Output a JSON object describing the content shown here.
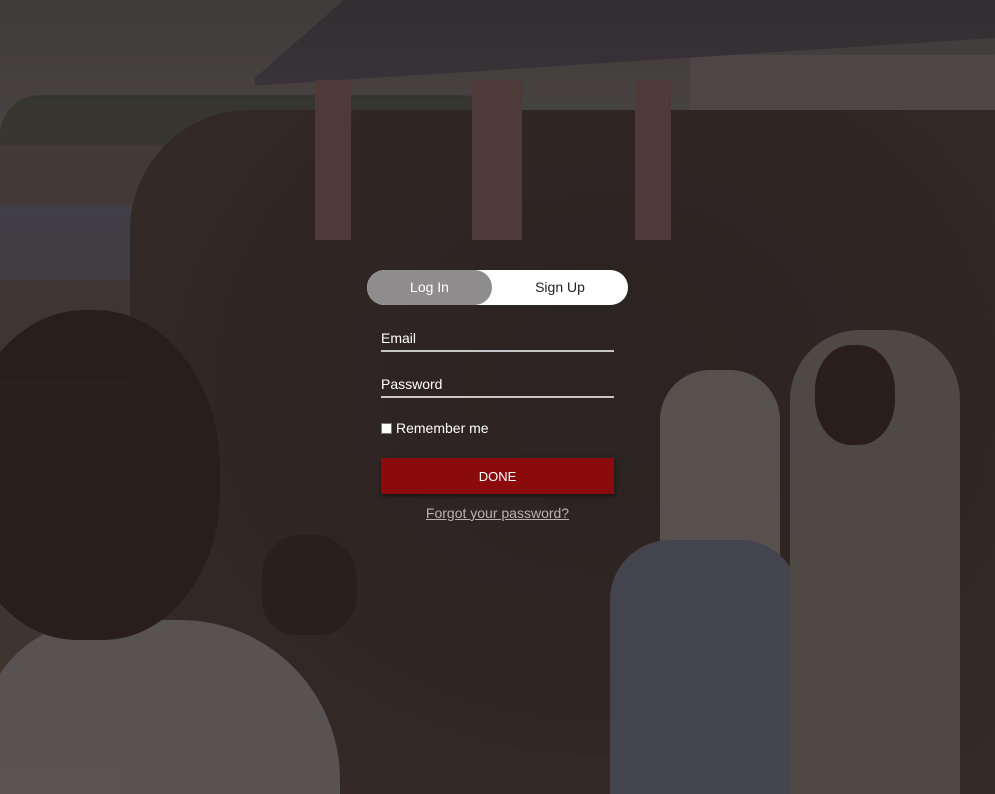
{
  "tabs": {
    "login": "Log In",
    "signup": "Sign Up"
  },
  "form": {
    "email_placeholder": "Email",
    "password_placeholder": "Password",
    "remember_label": "Remember me",
    "remember_checked": false,
    "done_label": "DONE",
    "forgot_label": "Forgot your password?"
  },
  "colors": {
    "active_tab": "#8e8c8c",
    "button": "#8b0b0d"
  }
}
